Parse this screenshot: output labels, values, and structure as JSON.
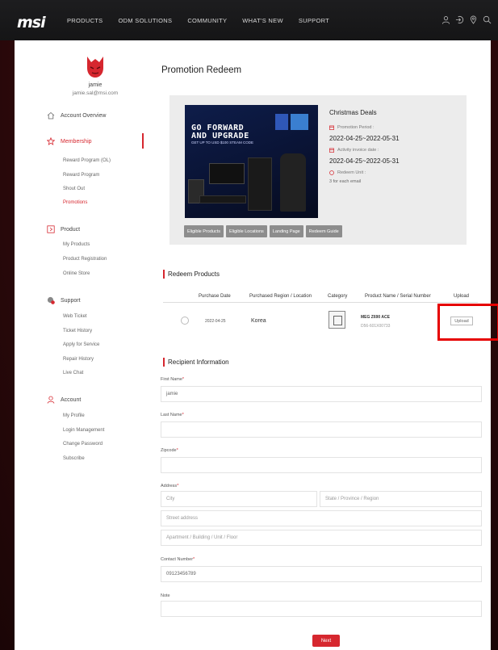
{
  "brand": {
    "logo_text": "msi",
    "accent_color": "#d6272f"
  },
  "topnav": {
    "links": [
      "PRODUCTS",
      "ODM SOLUTIONS",
      "COMMUNITY",
      "WHAT'S NEW",
      "SUPPORT"
    ],
    "icons": [
      "user-icon",
      "login-icon",
      "location-pin-icon",
      "search-icon"
    ]
  },
  "user": {
    "name": "jamie",
    "email": "jamie.sal@msi.com"
  },
  "sidebar": {
    "account_overview": "Account Overview",
    "membership": {
      "label": "Membership",
      "items": [
        "Reward Program (OL)",
        "Reward Program",
        "Shout Out",
        "Promotions"
      ]
    },
    "product": {
      "label": "Product",
      "items": [
        "My Products",
        "Product Registration",
        "Online Store"
      ]
    },
    "support": {
      "label": "Support",
      "items": [
        "Web Ticket",
        "Ticket History",
        "Apply for Service",
        "Repair History",
        "Live Chat"
      ]
    },
    "account": {
      "label": "Account",
      "items": [
        "My Profile",
        "Login Management",
        "Change Password",
        "Subscribe"
      ]
    }
  },
  "page_title": "Promotion Redeem",
  "promotion": {
    "banner": {
      "headline_1": "GO FORWARD",
      "headline_2": "AND UPGRADE",
      "subline": "GET UP TO USD $100 STEAM CODE"
    },
    "deal_title": "Christmas Deals",
    "promotion_period_label": "Promotion Period :",
    "promotion_period": "2022-04-25~2022-05-31",
    "activity_invoice_label": "Activity invoice date :",
    "activity_invoice": "2022-04-25~2022-05-31",
    "redeem_unit_label": "Redeem Unit :",
    "redeem_unit": "3 for each email",
    "tags": [
      "Eligible Products",
      "Eligible Locations",
      "Landing Page",
      "Redeem Guide"
    ]
  },
  "redeem_products": {
    "title": "Redeem Products",
    "columns": [
      "Purchase Date",
      "Purchased Region / Location",
      "Category",
      "Product Name / Serial Number",
      "Upload"
    ],
    "rows": [
      {
        "date": "2022-04-25",
        "region": "Korea",
        "product_name": "MEG Z690 ACE",
        "serial": "D56-601X00733",
        "upload_label": "Upload"
      }
    ]
  },
  "recipient": {
    "title": "Recipient Information",
    "first_name": {
      "label": "First Name",
      "value": "jamie"
    },
    "last_name": {
      "label": "Last Name",
      "value": ""
    },
    "zipcode": {
      "label": "Zipcode",
      "value": ""
    },
    "address": {
      "label": "Address",
      "city_placeholder": "City",
      "state_placeholder": "State / Province / Region",
      "street_placeholder": "Street address",
      "apartment_placeholder": "Apartment / Building / Unit / Floor"
    },
    "contact": {
      "label": "Contact Number",
      "value": "09123456789"
    },
    "note": {
      "label": "Note",
      "value": ""
    },
    "required_mark": "*"
  },
  "next_label": "Next"
}
